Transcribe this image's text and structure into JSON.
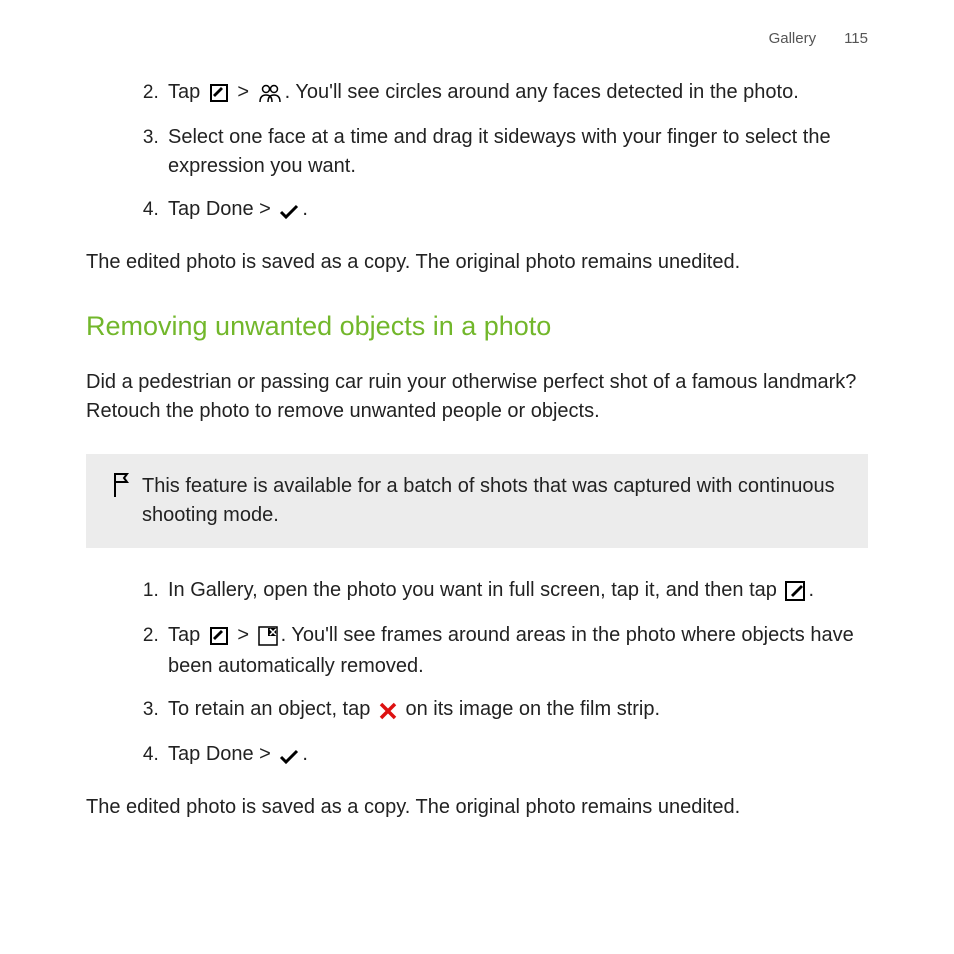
{
  "header": {
    "section": "Gallery",
    "page": "115"
  },
  "topSteps": {
    "start": 2,
    "items": [
      {
        "pre": "Tap ",
        "post": ". You'll see circles around any faces detected in the photo.",
        "gt": ">"
      },
      {
        "text": "Select one face at a time and drag it sideways with your finger to select the expression you want."
      },
      {
        "pre": "Tap ",
        "bold": "Done",
        "gt": " > ",
        "post": "."
      }
    ]
  },
  "copyNote1": "The edited photo is saved as a copy. The original photo remains unedited.",
  "sectionHeading": "Removing unwanted objects in a photo",
  "intro": "Did a pedestrian or passing car ruin your otherwise perfect shot of a famous landmark? Retouch the photo to remove unwanted people or objects.",
  "flagNote": "This feature is available for a batch of shots that was captured with continuous shooting mode.",
  "bottomSteps": {
    "items": [
      {
        "pre": "In Gallery, open the photo you want in full screen, tap it, and then tap ",
        "post": "."
      },
      {
        "pre": "Tap ",
        "gt": " > ",
        "post": ". You'll see frames around areas in the photo where objects have been automatically removed."
      },
      {
        "pre": "To retain an object, tap ",
        "post": " on its image on the film strip."
      },
      {
        "pre": "Tap ",
        "bold": "Done",
        "gt": " > ",
        "post": "."
      }
    ]
  },
  "copyNote2": "The edited photo is saved as a copy. The original photo remains unedited."
}
